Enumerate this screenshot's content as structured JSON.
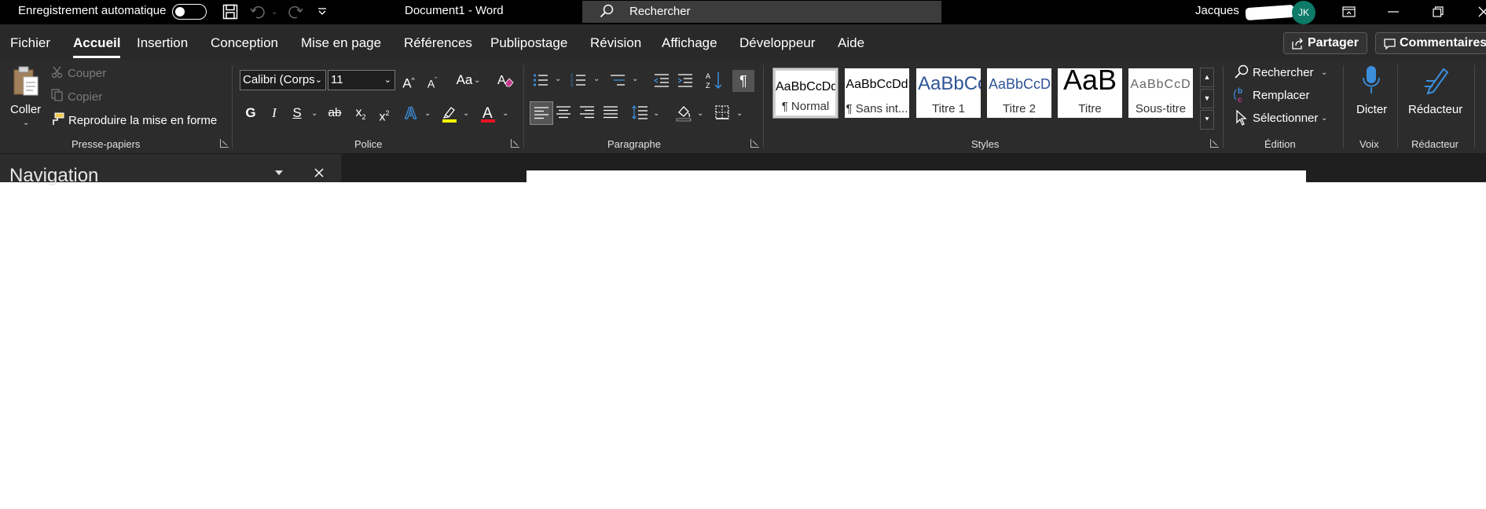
{
  "titlebar": {
    "autosave_label": "Enregistrement automatique",
    "doc_title": "Document1  -  Word",
    "search_label": "Rechercher",
    "user_name": "Jacques",
    "avatar_initials": "JK",
    "colors": {
      "bg": "#000000",
      "avatar": "#0e7a68"
    }
  },
  "tabs": [
    "Fichier",
    "Accueil",
    "Insertion",
    "Conception",
    "Mise en page",
    "Références",
    "Publipostage",
    "Révision",
    "Affichage",
    "Développeur",
    "Aide"
  ],
  "active_tab": "Accueil",
  "share_label": "Partager",
  "comments_label": "Commentaires",
  "clipboard": {
    "paste": "Coller",
    "cut": "Couper",
    "copy": "Copier",
    "format_painter": "Reproduire la mise en forme",
    "group": "Presse-papiers"
  },
  "font": {
    "name": "Calibri (Corps",
    "size": "11",
    "bold": "G",
    "italic": "I",
    "underline": "S",
    "strike": "ab",
    "subscript": "x",
    "subscript_mark": "2",
    "superscript": "x",
    "superscript_mark": "2",
    "grow": "A",
    "shrink": "A",
    "case": "Aa",
    "effects": "A",
    "highlight_color": "#ffff00",
    "font_color_mark": "A",
    "font_color": "#e81123",
    "group": "Police"
  },
  "paragraph": {
    "show_marks": "¶",
    "group": "Paragraphe"
  },
  "styles": {
    "items": [
      {
        "preview": "AaBbCcDd",
        "name": "¶ Normal"
      },
      {
        "preview": "AaBbCcDd",
        "name": "¶ Sans int..."
      },
      {
        "preview": "AaBbCc",
        "name": "Titre 1"
      },
      {
        "preview": "AaBbCcD",
        "name": "Titre 2"
      },
      {
        "preview": "AaB",
        "name": "Titre"
      },
      {
        "preview": "AaBbCcD",
        "name": "Sous-titre"
      }
    ],
    "group": "Styles"
  },
  "editing": {
    "find": "Rechercher",
    "replace": "Remplacer",
    "select": "Sélectionner",
    "group": "Édition"
  },
  "voice": {
    "dictate": "Dicter",
    "group": "Voix"
  },
  "editor": {
    "label": "Rédacteur",
    "group": "Rédacteur"
  },
  "navigation": {
    "title": "Navigation"
  }
}
